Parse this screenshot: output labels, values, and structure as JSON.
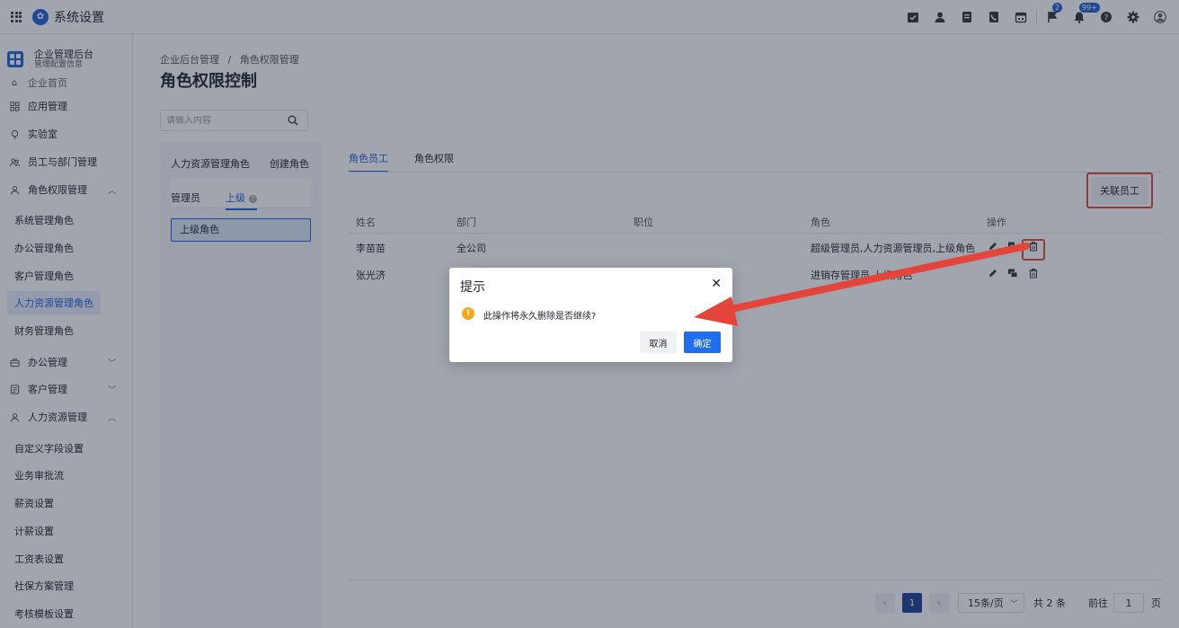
{
  "topbar": {
    "title": "系统设置",
    "badges": {
      "flag": "2",
      "bell": "99+"
    }
  },
  "sidebar": {
    "org_title": "企业管理后台",
    "org_subtitle": "管理配置信息",
    "hidden_item": "企业首页",
    "items": [
      {
        "label": "应用管理",
        "icon": "app-grid-icon"
      },
      {
        "label": "实验室",
        "icon": "bulb-icon"
      },
      {
        "label": "员工与部门管理",
        "icon": "users-icon"
      },
      {
        "label": "角色权限管理",
        "icon": "user-role-icon"
      }
    ],
    "role_sub": [
      "系统管理角色",
      "办公管理角色",
      "客户管理角色",
      "人力资源管理角色",
      "财务管理角色"
    ],
    "items2": [
      {
        "label": "办公管理",
        "icon": "briefcase-icon"
      },
      {
        "label": "客户管理",
        "icon": "contact-book-icon"
      },
      {
        "label": "人力资源管理",
        "icon": "person-icon"
      }
    ],
    "hr_sub": [
      "自定义字段设置",
      "业务审批流",
      "薪资设置",
      "计薪设置",
      "工资表设置",
      "社保方案管理",
      "考核模板设置"
    ]
  },
  "main": {
    "breadcrumb": [
      "企业后台管理",
      "/",
      "角色权限管理"
    ],
    "title": "角色权限控制",
    "search_placeholder": "请输入内容",
    "left_panel": {
      "heading": "人力资源管理角色",
      "create": "创建角色",
      "tabs": [
        "管理员",
        "上级"
      ],
      "selected_role": "上级角色"
    },
    "tabs": [
      "角色员工",
      "角色权限"
    ],
    "associate_button": "关联员工",
    "table": {
      "headers": [
        "姓名",
        "部门",
        "职位",
        "角色",
        "操作"
      ],
      "rows": [
        {
          "name": "李苗苗",
          "dept": "全公司",
          "position": "",
          "role": "超级管理员,人力资源管理员,上级角色"
        },
        {
          "name": "张光济",
          "dept": "",
          "position": "",
          "role": "进销存管理员,上级角色"
        }
      ]
    },
    "pagination": {
      "current": "1",
      "page_size": "15条/页",
      "total": "共 2 条",
      "goto_label": "前往",
      "goto_value": "1",
      "goto_unit": "页"
    }
  },
  "dialog": {
    "title": "提示",
    "message": "此操作将永久删除是否继续?",
    "cancel": "取消",
    "confirm": "确定"
  },
  "colors": {
    "accent": "#1f5fd6",
    "primary_button": "#1f6ef0",
    "highlight": "#e4453a",
    "warning": "#f5a623"
  }
}
